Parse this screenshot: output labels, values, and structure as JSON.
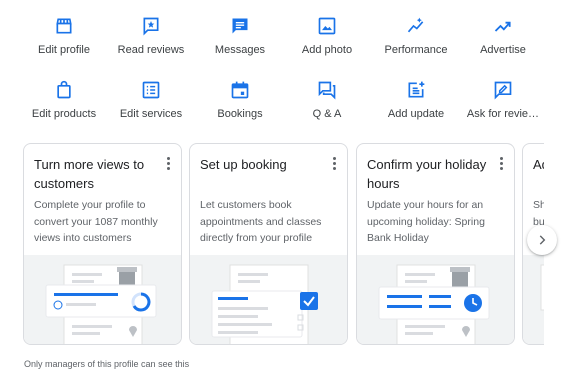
{
  "actions_row1": [
    {
      "label": "Edit profile",
      "icon": "storefront-icon"
    },
    {
      "label": "Read reviews",
      "icon": "star-review-icon"
    },
    {
      "label": "Messages",
      "icon": "message-icon"
    },
    {
      "label": "Add photo",
      "icon": "photo-icon"
    },
    {
      "label": "Performance",
      "icon": "performance-sparkle-icon"
    },
    {
      "label": "Advertise",
      "icon": "trending-up-icon"
    }
  ],
  "actions_row2": [
    {
      "label": "Edit products",
      "icon": "shopping-bag-icon"
    },
    {
      "label": "Edit services",
      "icon": "list-icon"
    },
    {
      "label": "Bookings",
      "icon": "calendar-icon"
    },
    {
      "label": "Q & A",
      "icon": "question-answer-icon"
    },
    {
      "label": "Add update",
      "icon": "post-add-icon"
    },
    {
      "label": "Ask for revie…",
      "icon": "rate-review-icon"
    }
  ],
  "cards": [
    {
      "title": "Turn more views to customers",
      "description": "Complete your profile to convert your 1087 monthly views into customers"
    },
    {
      "title": "Set up booking",
      "description": "Let customers book appointments and classes directly from your profile"
    },
    {
      "title": "Confirm your holiday hours",
      "description": "Update your hours for an upcoming holiday: Spring Bank Holiday"
    },
    {
      "title": "Ad",
      "description": "Sh bu"
    }
  ],
  "footer_note": "Only managers of this profile can see this",
  "colors": {
    "accent": "#1a73e8",
    "card_border": "#dadce0",
    "illustration_bg": "#f1f3f4"
  }
}
